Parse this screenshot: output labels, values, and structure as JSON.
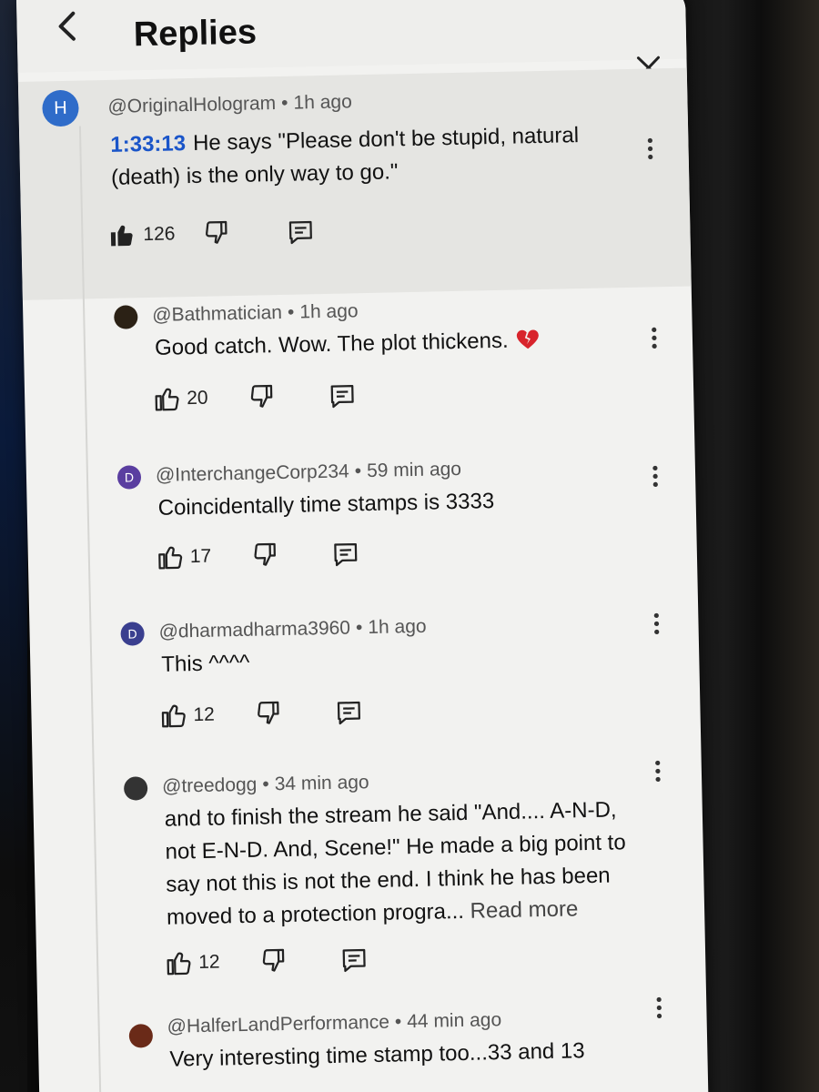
{
  "header": {
    "title": "Replies"
  },
  "parent": {
    "avatar_letter": "H",
    "avatar_color": "#2f6cc9",
    "author": "@OriginalHologram",
    "time": "1h ago",
    "timestamp_link": "1:33:13",
    "text": "He says \"Please don't be stupid, natural (death) is the only way to go.\"",
    "likes": "126"
  },
  "replies": [
    {
      "author": "@Bathmatician",
      "time": "1h ago",
      "text": "Good catch. Wow. The plot thickens.",
      "emoji": "broken-heart",
      "likes": "20",
      "avatar_color": "#2b2115"
    },
    {
      "author": "@InterchangeCorp234",
      "time": "59 min ago",
      "text": "Coincidentally time stamps is 3333",
      "likes": "17",
      "avatar_letter": "D",
      "avatar_color": "#5a3ea0"
    },
    {
      "author": "@dharmadharma3960",
      "time": "1h ago",
      "text": "This ^^^^",
      "likes": "12",
      "avatar_letter": "D",
      "avatar_color": "#3a3f8f"
    },
    {
      "author": "@treedogg",
      "time": "34 min ago",
      "text": "and to finish the stream he said \"And.... A-N-D, not E-N-D. And, Scene!\"  He made a big point to say not this is not the end. I think he has been moved to a protection progra...",
      "read_more": "Read more",
      "likes": "12",
      "avatar_color": "#333333"
    },
    {
      "author": "@HalferLandPerformance",
      "time": "44 min ago",
      "text": "Very interesting time stamp too...33 and 13",
      "avatar_color": "#6a2a18"
    }
  ],
  "icons": {
    "back": "chevron-left-icon",
    "close": "close-icon",
    "like": "thumbs-up-icon",
    "dislike": "thumbs-down-icon",
    "reply": "reply-icon",
    "menu": "more-vert-icon"
  }
}
